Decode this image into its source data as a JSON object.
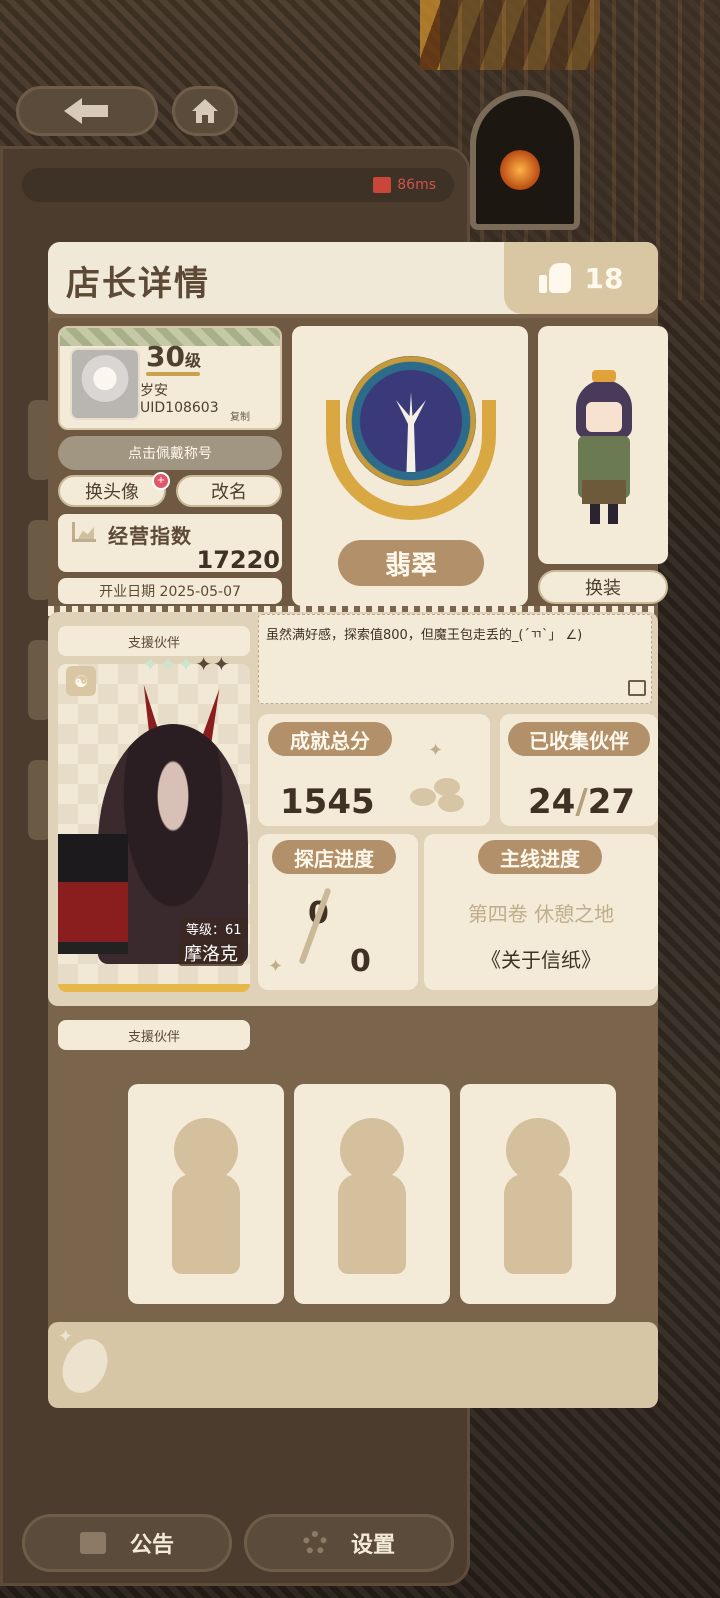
{
  "ping": {
    "value": "86ms"
  },
  "header": {
    "title": "店长详情",
    "likes": "18"
  },
  "profile": {
    "level": "30",
    "level_unit": "级",
    "name": "岁安",
    "uid": "UID108603",
    "copy_label": "复制",
    "title_button": "点击佩戴称号",
    "change_avatar": "换头像",
    "rename": "改名",
    "new_dot": "+"
  },
  "business": {
    "label": "经营指数",
    "value": "17220",
    "open_date": "开业日期 2025-05-07"
  },
  "rank": {
    "label": "翡翠"
  },
  "outfit": {
    "button": "换装"
  },
  "support": {
    "tag": "支援伙伴",
    "stars": "✦✦✦",
    "stars_dim": "✦✦",
    "level_label": "等级：61",
    "name": "摩洛克",
    "class_icon": "☯"
  },
  "signature": {
    "text": "虽然满好感，探索值800，但魔王包走丢的_(´ㄲ`」 ∠)"
  },
  "stats": {
    "achievement_label": "成就总分",
    "achievement_value": "1545",
    "collected_label": "已收集伙伴",
    "collected_have": "24",
    "collected_total": "27",
    "explore_label": "探店进度",
    "explore_top": "0",
    "explore_bottom": "0",
    "main_label": "主线进度",
    "main_chapter": "第四卷 休憩之地",
    "main_title": "《关于信纸》"
  },
  "support2": {
    "tag": "支援伙伴"
  },
  "bottom": {
    "notice": "公告",
    "settings": "设置"
  },
  "icons": [
    "back-arrow-icon",
    "home-icon",
    "signal-icon",
    "thumbs-up-icon",
    "chart-icon",
    "edit-icon",
    "coffee-bean-icon",
    "gear-icon",
    "notice-icon"
  ]
}
